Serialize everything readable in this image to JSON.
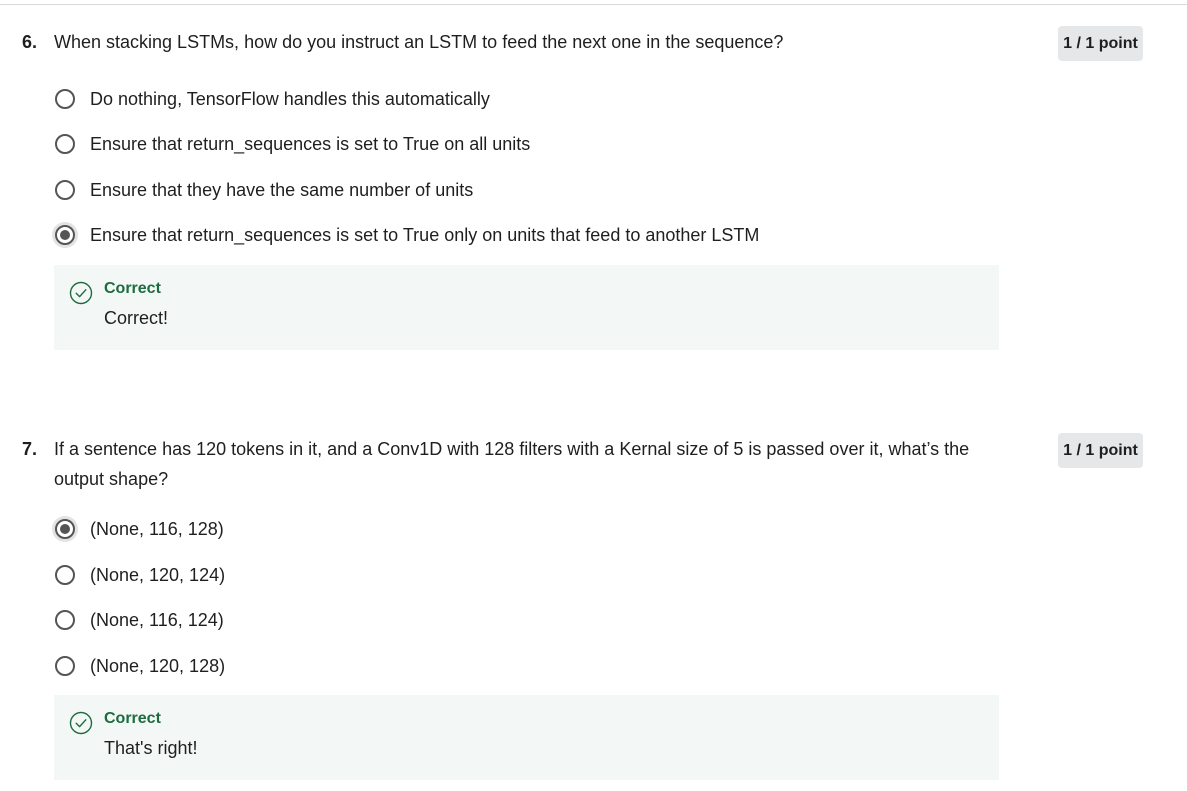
{
  "questions": [
    {
      "number": "6.",
      "text": "When stacking LSTMs, how do you instruct an LSTM to feed the next one in the sequence?",
      "points": "1 / 1 point",
      "options": [
        {
          "label": "Do nothing, TensorFlow handles this automatically",
          "selected": false
        },
        {
          "label": "Ensure that return_sequences is set to True on all units",
          "selected": false
        },
        {
          "label": "Ensure that they have the same number of units",
          "selected": false
        },
        {
          "label": "Ensure that return_sequences is set to True only on units that feed to another LSTM",
          "selected": true
        }
      ],
      "feedback": {
        "title": "Correct",
        "text": "Correct!"
      }
    },
    {
      "number": "7.",
      "text": "If a sentence has 120 tokens in it, and a Conv1D with 128 filters with a Kernal size of 5 is passed over it, what’s the output shape?",
      "points": "1 / 1 point",
      "options": [
        {
          "label": "(None, 116, 128)",
          "selected": true
        },
        {
          "label": "(None, 120, 124)",
          "selected": false
        },
        {
          "label": "(None, 116, 124)",
          "selected": false
        },
        {
          "label": "(None, 120, 128)",
          "selected": false
        }
      ],
      "feedback": {
        "title": "Correct",
        "text": "That's right!"
      }
    }
  ],
  "colors": {
    "correct_green": "#1e6b3f",
    "feedback_bg": "#f3f8f6",
    "badge_bg": "#e5e7e8",
    "radio_border": "#555555"
  },
  "icons": {
    "feedback": "check-circle-icon",
    "option": "radio-icon"
  }
}
